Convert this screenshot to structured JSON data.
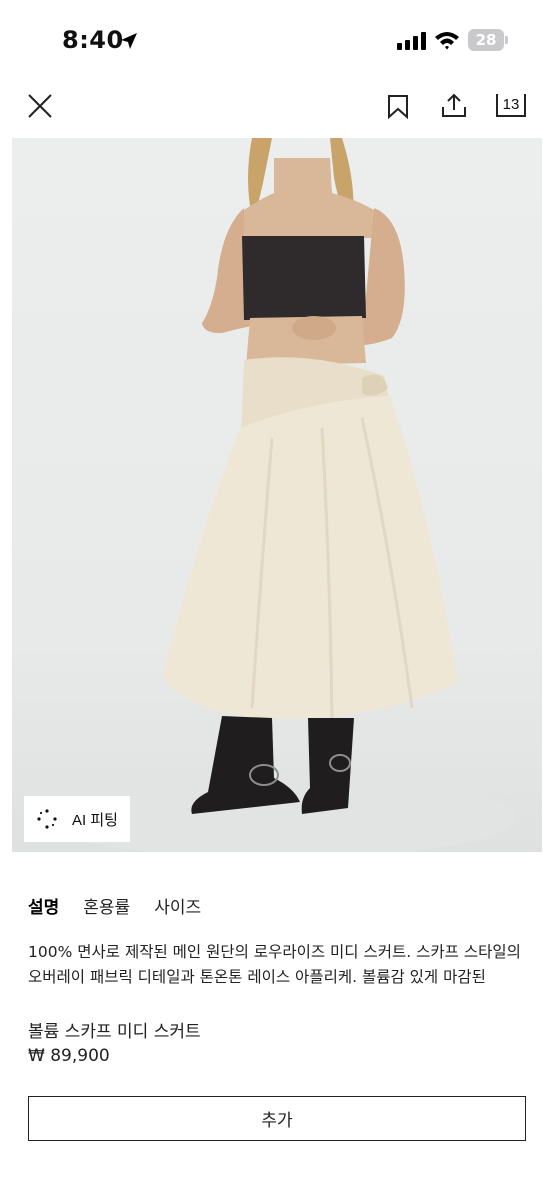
{
  "status_bar": {
    "time": "8:40",
    "battery": "28"
  },
  "nav": {
    "cart_count": "13"
  },
  "image": {
    "ai_fitting_label": "AI 피팅"
  },
  "tabs": [
    {
      "label": "설명",
      "active": true
    },
    {
      "label": "혼용률",
      "active": false
    },
    {
      "label": "사이즈",
      "active": false
    }
  ],
  "product": {
    "description": "100% 면사로 제작된 메인 원단의 로우라이즈 미디 스커트. 스카프 스타일의 오버레이 패브릭 디테일과 톤온톤 레이스 아플리케. 볼륨감 있게 마감된",
    "name": "볼륨 스카프 미디 스커트",
    "price": "₩ 89,900"
  },
  "actions": {
    "add_label": "추가"
  },
  "colors": {
    "skirt": "#efe7d6",
    "top": "#2f2b2c",
    "boots": "#1f1d1d",
    "background": "#eceeee"
  }
}
